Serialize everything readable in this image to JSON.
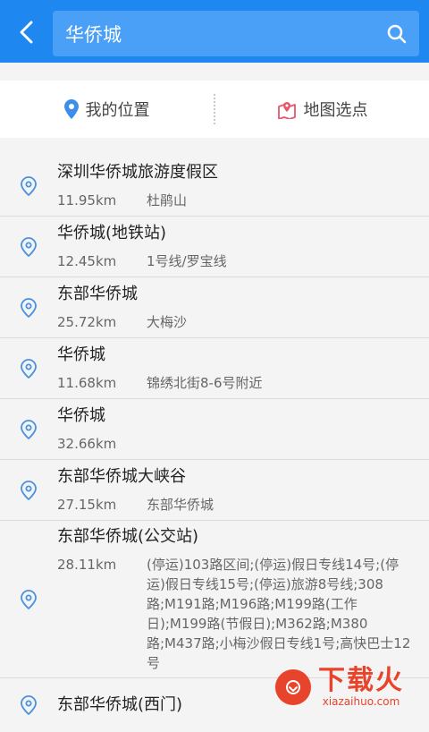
{
  "search": {
    "value": "华侨城"
  },
  "quick": {
    "my_location": "我的位置",
    "map_pick": "地图选点"
  },
  "results": [
    {
      "name": "深圳华侨城旅游度假区",
      "distance": "11.95km",
      "address": "杜鹃山"
    },
    {
      "name": "华侨城(地铁站)",
      "distance": "12.45km",
      "address": "1号线/罗宝线"
    },
    {
      "name": "东部华侨城",
      "distance": "25.72km",
      "address": "大梅沙"
    },
    {
      "name": "华侨城",
      "distance": "11.68km",
      "address": "锦绣北街8-6号附近"
    },
    {
      "name": "华侨城",
      "distance": "32.66km",
      "address": ""
    },
    {
      "name": "东部华侨城大峡谷",
      "distance": "27.15km",
      "address": "东部华侨城"
    },
    {
      "name": "东部华侨城(公交站)",
      "distance": "28.11km",
      "address": "(停运)103路区间;(停运)假日专线14号;(停运)假日专线15号;(停运)旅游8号线;308路;M191路;M196路;M199路(工作日);M199路(节假日);M362路;M380路;M437路;小梅沙假日专线1号;高快巴士12号"
    },
    {
      "name": "东部华侨城(西门)",
      "distance": "",
      "address": ""
    }
  ],
  "watermark": {
    "title": "下载火",
    "subtitle": "xiazaihuo.com"
  },
  "colors": {
    "header": "#1e88f0",
    "search_box": "#4aa0f6",
    "pin": "#4a90e2",
    "map_pick_icon": "#e8566c",
    "watermark": "#e8432b"
  },
  "icons": {
    "back": "back-arrow-icon",
    "search": "search-icon",
    "location": "location-pin-icon",
    "map": "map-pin-icon",
    "result": "location-outline-icon"
  }
}
